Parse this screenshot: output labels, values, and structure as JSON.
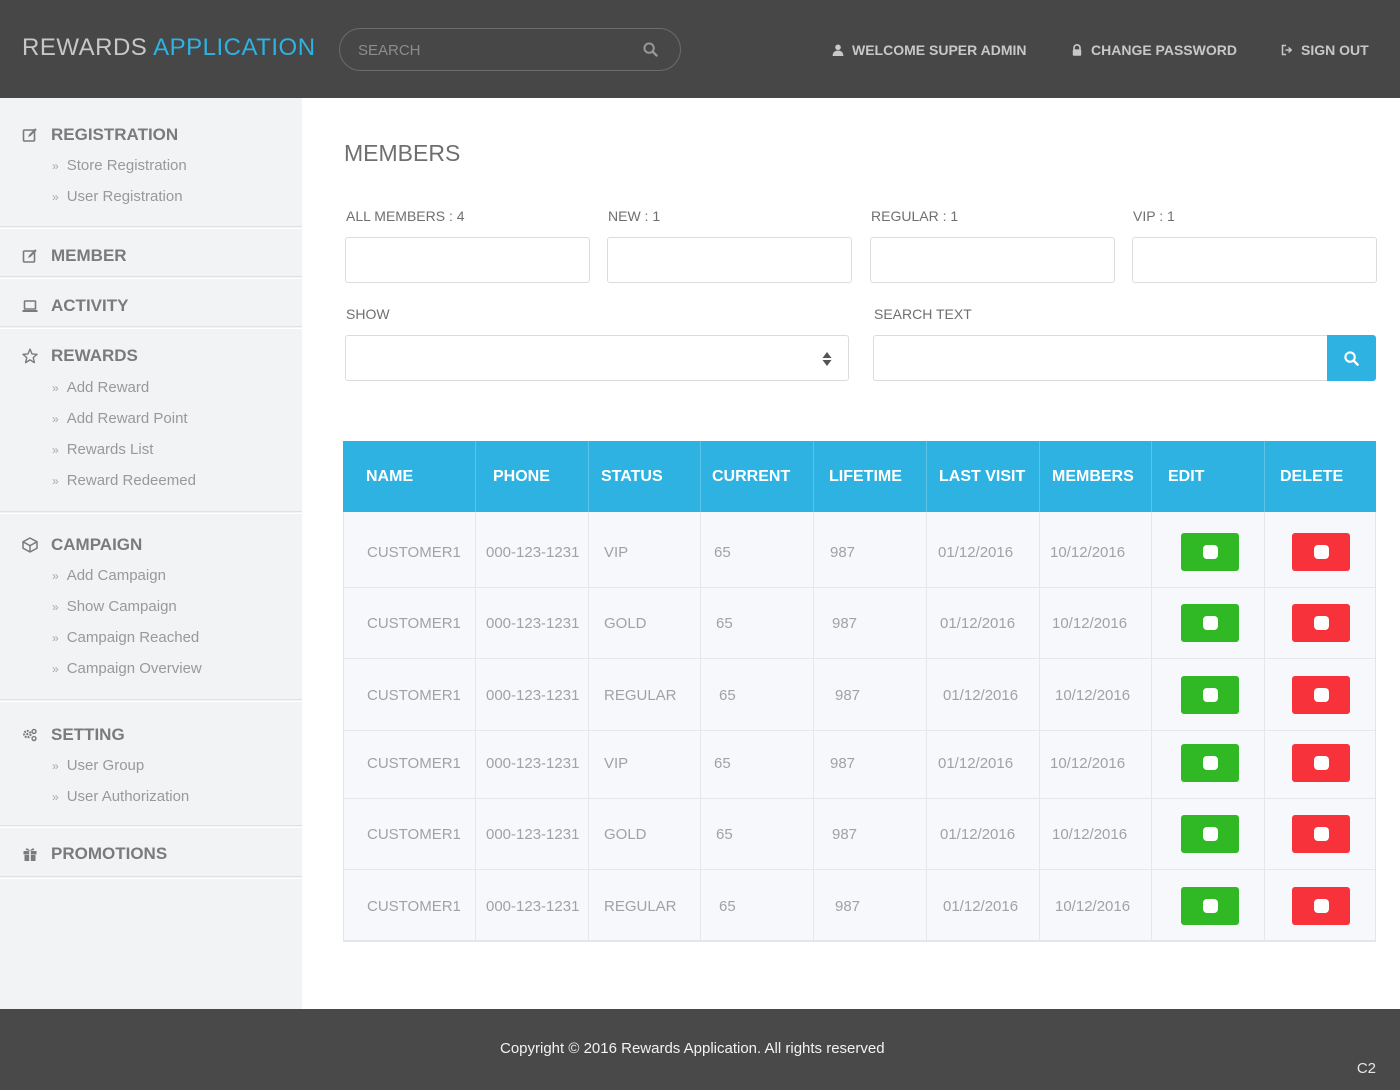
{
  "header": {
    "brand_part1": "REWARDS",
    "brand_part2": "APPLICATION",
    "search_placeholder": "SEARCH",
    "welcome": "WELCOME SUPER ADMIN",
    "change_password": "CHANGE PASSWORD",
    "sign_out": "SIGN OUT"
  },
  "sidebar": {
    "registration": {
      "label": "REGISTRATION",
      "items": [
        "Store Registration",
        "User Registration"
      ]
    },
    "member": {
      "label": "MEMBER"
    },
    "activity": {
      "label": "ACTIVITY"
    },
    "rewards": {
      "label": "REWARDS",
      "items": [
        "Add Reward",
        "Add Reward Point",
        "Rewards List",
        "Reward Redeemed"
      ]
    },
    "campaign": {
      "label": "CAMPAIGN",
      "items": [
        "Add Campaign",
        "Show Campaign",
        "Campaign Reached",
        "Campaign Overview"
      ]
    },
    "setting": {
      "label": "SETTING",
      "items": [
        "User Group",
        "User Authorization"
      ]
    },
    "promotions": {
      "label": "PROMOTIONS"
    }
  },
  "main": {
    "title": "MEMBERS",
    "counts": [
      "ALL MEMBERS : 4",
      "NEW : 1",
      "REGULAR : 1",
      "VIP : 1"
    ],
    "show_label": "SHOW",
    "search_text_label": "SEARCH TEXT"
  },
  "table": {
    "headers": [
      "NAME",
      "PHONE",
      "STATUS",
      "CURRENT",
      "LIFETIME",
      "LAST VISIT",
      "MEMBERS",
      "EDIT",
      "DELETE"
    ],
    "rows": [
      [
        "CUSTOMER1",
        "000-123-1231",
        "VIP",
        "65",
        "987",
        "01/12/2016",
        "10/12/2016"
      ],
      [
        "CUSTOMER1",
        "000-123-1231",
        "GOLD",
        "65",
        "987",
        "01/12/2016",
        "10/12/2016"
      ],
      [
        "CUSTOMER1",
        "000-123-1231",
        "REGULAR",
        "65",
        "987",
        "01/12/2016",
        "10/12/2016"
      ],
      [
        "CUSTOMER1",
        "000-123-1231",
        "VIP",
        "65",
        "987",
        "01/12/2016",
        "10/12/2016"
      ],
      [
        "CUSTOMER1",
        "000-123-1231",
        "GOLD",
        "65",
        "987",
        "01/12/2016",
        "10/12/2016"
      ],
      [
        "CUSTOMER1",
        "000-123-1231",
        "REGULAR",
        "65",
        "987",
        "01/12/2016",
        "10/12/2016"
      ]
    ]
  },
  "footer": {
    "copyright": "Copyright © 2016 Rewards Application. All rights reserved",
    "code": "C2"
  },
  "colors": {
    "accent": "#2eb2e2",
    "header_bg": "#474747",
    "edit_green": "#30b924",
    "delete_red": "#f8323a"
  }
}
